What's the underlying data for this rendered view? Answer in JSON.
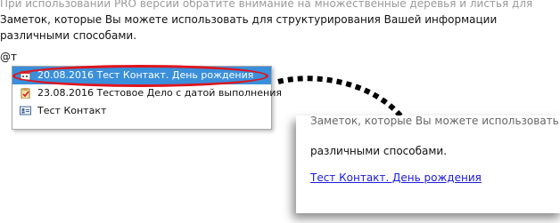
{
  "editor": {
    "line0": "При использовании PRO версии обратите внимание на множественные деревья и листья для",
    "line1": "Заметок, которые Вы можете использовать для структурирования Вашей информации",
    "line2": "различными способами.",
    "typed": "@т"
  },
  "popup": {
    "items": [
      {
        "date": "20.08.2016",
        "label": "Тест Контакт. День рождения",
        "icon": "calendar-icon",
        "selected": true
      },
      {
        "date": "23.08.2016",
        "label": "Тестовое Дело с датой выполнения",
        "icon": "task-clipboard-icon",
        "selected": false
      },
      {
        "date": "",
        "label": "Тест Контакт",
        "icon": "contact-card-icon",
        "selected": false
      }
    ]
  },
  "zoom": {
    "line1": "Заметок, которые Вы можете использовать для",
    "line2": "различными способами.",
    "link": "Тест Контакт. День рождения"
  },
  "colors": {
    "selection": "#3a8fdb",
    "highlight_ring": "#e0141c",
    "link": "#1a1ae0"
  }
}
